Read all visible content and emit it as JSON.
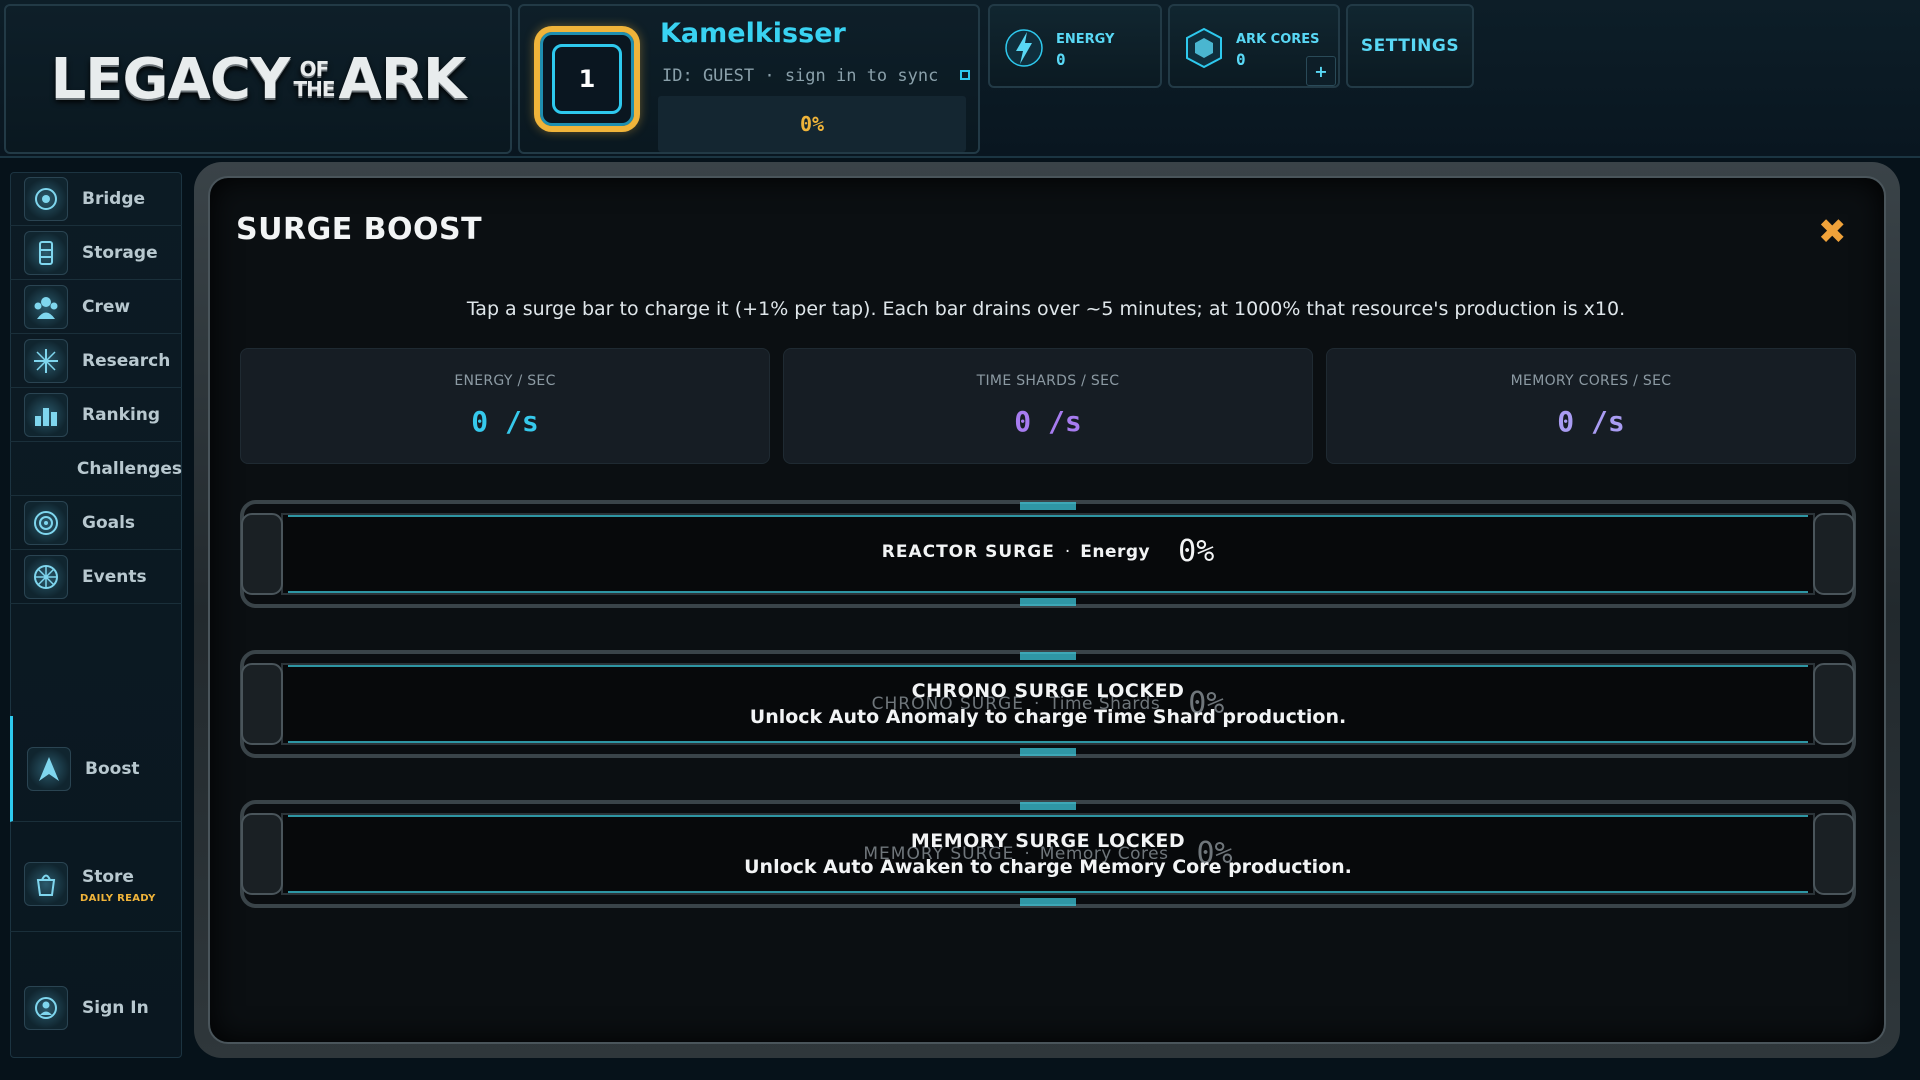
{
  "logo": {
    "part1": "LEGACY",
    "of": "OF",
    "the": "THE",
    "part2": "ARK"
  },
  "profile": {
    "level": "1",
    "username": "Kamelkisser",
    "id_text": "ID: GUEST · sign in to sync",
    "progress_text": "0%"
  },
  "resources": {
    "energy": {
      "label": "ENERGY",
      "value": "0",
      "icon": "lightning-icon"
    },
    "ark_cores": {
      "label": "ARK CORES",
      "value": "0",
      "icon": "hex-core-icon"
    },
    "plus_label": "+"
  },
  "settings_label": "SETTINGS",
  "sidebar": {
    "items": [
      {
        "label": "Bridge",
        "icon": "bridge-icon"
      },
      {
        "label": "Storage",
        "icon": "storage-icon"
      },
      {
        "label": "Crew",
        "icon": "crew-icon"
      },
      {
        "label": "Research",
        "icon": "research-icon"
      },
      {
        "label": "Ranking",
        "icon": "ranking-icon"
      },
      {
        "label": "Challenges",
        "icon": ""
      },
      {
        "label": "Goals",
        "icon": "goals-icon"
      },
      {
        "label": "Events",
        "icon": "events-icon"
      },
      {
        "label": "Boost",
        "icon": "boost-icon"
      },
      {
        "label": "Store",
        "icon": "store-icon",
        "sub": "DAILY READY"
      },
      {
        "label": "Sign In",
        "icon": "sign-in-icon"
      }
    ]
  },
  "panel": {
    "title": "SURGE BOOST",
    "close": "✖",
    "instructions": "Tap a surge bar to charge it (+1% per tap). Each bar drains over ~5 minutes; at 1000% that resource's production is x10."
  },
  "stats": [
    {
      "label": "ENERGY / SEC",
      "value": "0 /s",
      "color": "#36c9ec"
    },
    {
      "label": "TIME SHARDS / SEC",
      "value": "0 /s",
      "color": "#a77cf0"
    },
    {
      "label": "MEMORY CORES / SEC",
      "value": "0 /s",
      "color": "#a99cf2"
    }
  ],
  "surges": [
    {
      "name": "REACTOR SURGE",
      "dot": "·",
      "resource": "Energy",
      "percent": "0%",
      "locked": false
    },
    {
      "name": "CHRONO SURGE",
      "dot": "·",
      "resource": "Time Shards",
      "percent": "0%",
      "locked": true,
      "lock_title": "CHRONO SURGE LOCKED",
      "lock_msg": "Unlock Auto Anomaly to charge Time Shard production."
    },
    {
      "name": "MEMORY SURGE",
      "dot": "·",
      "resource": "Memory Cores",
      "percent": "0%",
      "locked": true,
      "lock_title": "MEMORY SURGE LOCKED",
      "lock_msg": "Unlock Auto Awaken to charge Memory Core production."
    }
  ],
  "colors": {
    "accent": "#2ec9ee",
    "gold": "#f0b43a",
    "close": "#f0a23a"
  }
}
